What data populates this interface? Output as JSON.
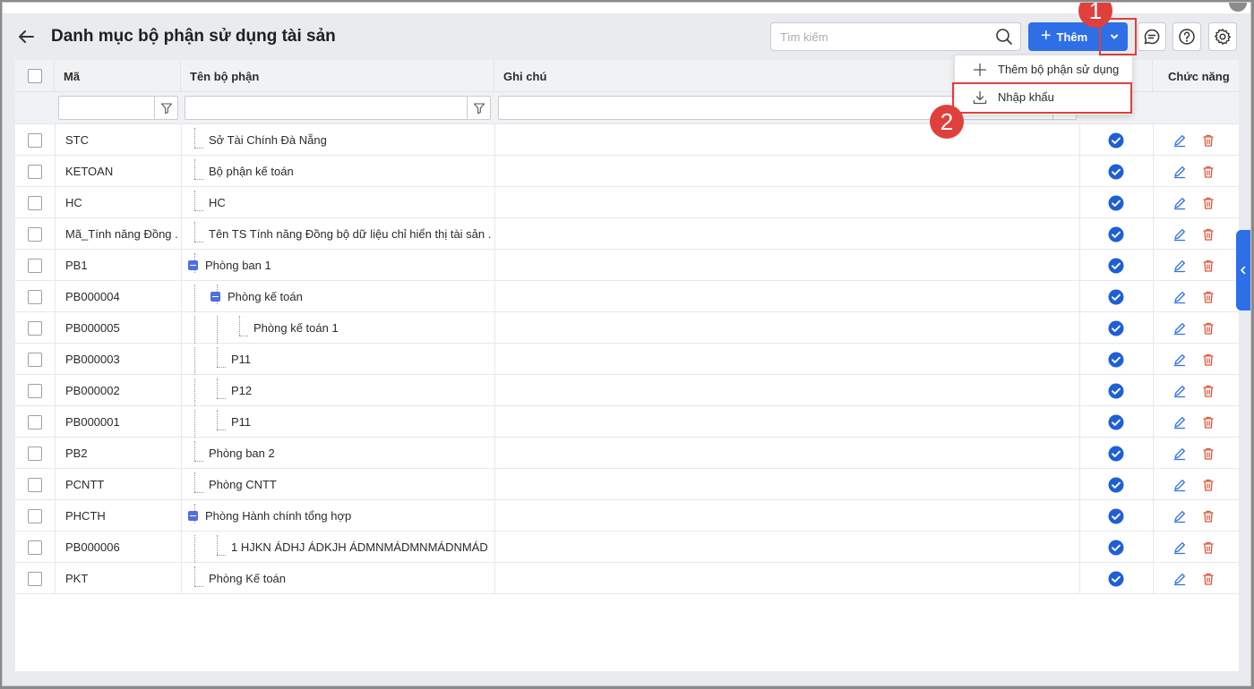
{
  "header": {
    "title": "Danh mục bộ phận sử dụng tài sản",
    "search_placeholder": "Tìm kiếm",
    "add_label": "Thêm"
  },
  "menu": {
    "items": [
      "Thêm bộ phận sử dụng",
      "Nhập khẩu"
    ]
  },
  "badges": [
    "1",
    "2"
  ],
  "columns": {
    "code": "Mã",
    "name": "Tên bộ phận",
    "note": "Ghi chú",
    "actions": "Chức năng"
  },
  "rows": [
    {
      "code": "STC",
      "name": "Sở Tài Chính Đà Nẵng",
      "level": 0,
      "collapsible": false,
      "active": true
    },
    {
      "code": "KETOAN",
      "name": "Bộ phận kế toán",
      "level": 0,
      "collapsible": false,
      "active": true
    },
    {
      "code": "HC",
      "name": "HC",
      "level": 0,
      "collapsible": false,
      "active": true
    },
    {
      "code": "Mã_Tính năng Đồng ...",
      "name": "Tên TS Tính năng Đồng bộ dữ liệu chỉ hiển thị tài sản ...",
      "level": 0,
      "collapsible": false,
      "active": true
    },
    {
      "code": "PB1",
      "name": "Phòng ban 1",
      "level": 0,
      "collapsible": true,
      "active": true
    },
    {
      "code": "PB000004",
      "name": "Phòng kế toán",
      "level": 1,
      "collapsible": true,
      "active": true
    },
    {
      "code": "PB000005",
      "name": "Phòng kế toán 1",
      "level": 2,
      "collapsible": false,
      "active": true
    },
    {
      "code": "PB000003",
      "name": "P11",
      "level": 1,
      "collapsible": false,
      "active": true
    },
    {
      "code": "PB000002",
      "name": "P12",
      "level": 1,
      "collapsible": false,
      "active": true
    },
    {
      "code": "PB000001",
      "name": "P11",
      "level": 1,
      "collapsible": false,
      "active": true
    },
    {
      "code": "PB2",
      "name": "Phòng ban 2",
      "level": 0,
      "collapsible": false,
      "active": true
    },
    {
      "code": "PCNTT",
      "name": "Phòng CNTT",
      "level": 0,
      "collapsible": false,
      "active": true
    },
    {
      "code": "PHCTH",
      "name": "Phòng Hành chính tổng hợp",
      "level": 0,
      "collapsible": true,
      "active": true
    },
    {
      "code": "PB000006",
      "name": "1 HJKN ÁDHJ ÁDKJH ÁDMNMÁDMNMÁDNMÁD",
      "level": 1,
      "collapsible": false,
      "active": true
    },
    {
      "code": "PKT",
      "name": "Phòng Kế toán",
      "level": 0,
      "collapsible": false,
      "active": true
    }
  ],
  "colors": {
    "primary": "#2e6fe8",
    "highlight": "#e0403c",
    "delete": "#e0553a",
    "check": "#1f5fd6"
  }
}
